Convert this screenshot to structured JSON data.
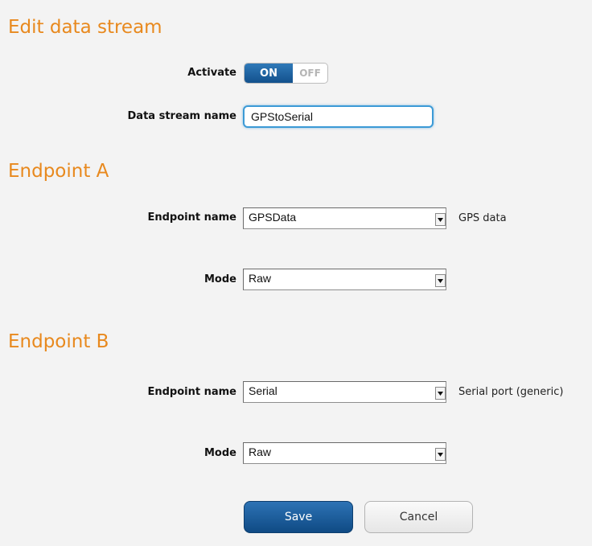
{
  "header": {
    "title": "Edit data stream"
  },
  "activate": {
    "label": "Activate",
    "on_label": "ON",
    "off_label": "OFF",
    "value": "ON"
  },
  "stream_name": {
    "label": "Data stream name",
    "value": "GPStoSerial"
  },
  "endpoint_a": {
    "title": "Endpoint A",
    "name_label": "Endpoint name",
    "name_value": "GPSData",
    "name_description": "GPS data",
    "mode_label": "Mode",
    "mode_value": "Raw"
  },
  "endpoint_b": {
    "title": "Endpoint B",
    "name_label": "Endpoint name",
    "name_value": "Serial",
    "name_description": "Serial port (generic)",
    "mode_label": "Mode",
    "mode_value": "Raw"
  },
  "actions": {
    "save_label": "Save",
    "cancel_label": "Cancel"
  },
  "colors": {
    "heading": "#e8891e",
    "primary": "#13518d",
    "focus": "#3c9ad6"
  },
  "icons": {
    "select_arrow": "triangle-down-icon"
  }
}
